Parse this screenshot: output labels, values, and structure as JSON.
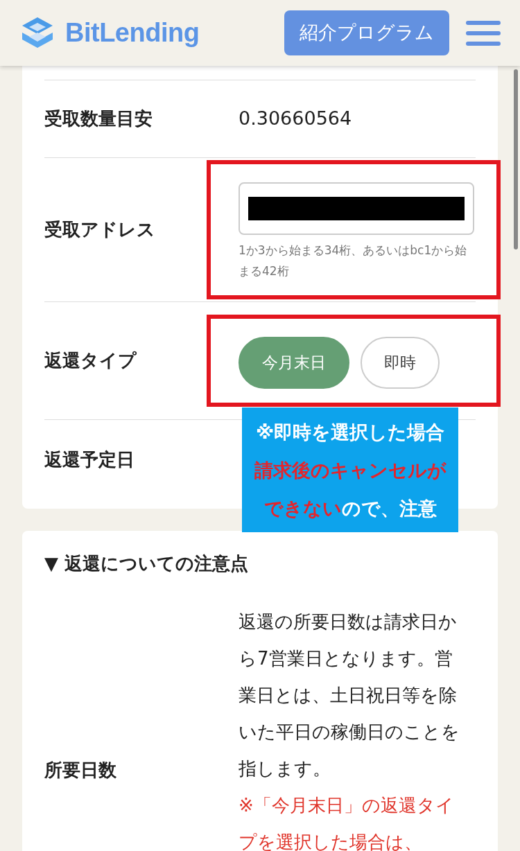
{
  "header": {
    "logo_text": "BitLending",
    "referral_button": "紹介プログラム"
  },
  "form_rows": [
    {
      "kind": "text",
      "label": "受取数量目安",
      "value": "0.30660564",
      "highlighted": false
    },
    {
      "kind": "address",
      "label": "受取アドレス",
      "hint": "1か3から始まる34桁、あるいはbc1から始まる42桁",
      "highlighted": true
    },
    {
      "kind": "toggle",
      "label": "返還タイプ",
      "options": [
        {
          "label": "今月末日",
          "selected": true
        },
        {
          "label": "即時",
          "selected": false
        }
      ],
      "highlighted": true
    },
    {
      "kind": "text",
      "label": "返還予定日",
      "highlighted": false
    }
  ],
  "callout": {
    "lines": [
      [
        {
          "text": "※即時を選択した場合",
          "kind": "plain"
        }
      ],
      [
        {
          "text": "請求後のキャンセルが",
          "kind": "warning"
        }
      ],
      [
        {
          "text": "できない",
          "kind": "warning"
        },
        {
          "text": "ので、注意",
          "kind": "plain"
        }
      ]
    ]
  },
  "notes": {
    "heading": "▼ 返還についての注意点",
    "rows": [
      {
        "label": "所要日数",
        "text": "返還の所要日数は請求日から7営業日となります。営業日とは、土日祝日等を除いた平日の稼働日のことを指します。",
        "warning": "※「今月末日」の返還タイプを選択した場合は、"
      }
    ]
  }
}
